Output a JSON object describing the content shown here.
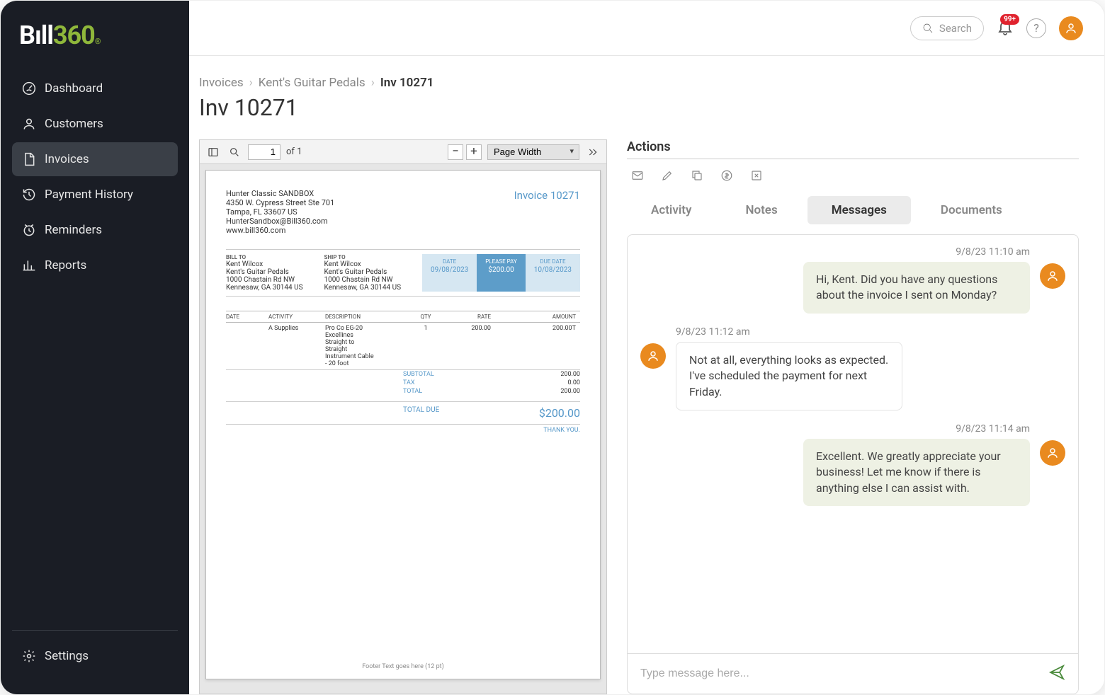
{
  "brand": {
    "part1": "B",
    "part2": "ıll",
    "part3": "360",
    "reg": "®"
  },
  "sidebar": {
    "items": [
      {
        "label": "Dashboard"
      },
      {
        "label": "Customers"
      },
      {
        "label": "Invoices"
      },
      {
        "label": "Payment History"
      },
      {
        "label": "Reminders"
      },
      {
        "label": "Reports"
      }
    ],
    "settings": "Settings"
  },
  "topbar": {
    "search_placeholder": "Search",
    "notification_badge": "99+"
  },
  "breadcrumb": {
    "c1": "Invoices",
    "c2": "Kent's Guitar Pedals",
    "c3": "Inv 10271"
  },
  "page_title": "Inv 10271",
  "pdf": {
    "page": "1",
    "of_label": "of 1",
    "zoom_mode": "Page Width"
  },
  "invoice": {
    "title": "Invoice  10271",
    "from": {
      "name": "Hunter Classic SANDBOX",
      "addr1": "4350 W. Cypress Street Ste 701",
      "addr2": "Tampa, FL  33607 US",
      "email": "HunterSandbox@Bill360.com",
      "web": "www.bill360.com"
    },
    "bill_to_label": "BILL TO",
    "ship_to_label": "SHIP TO",
    "bill_to": {
      "name": "Kent Wilcox",
      "company": "Kent's Guitar Pedals",
      "street": "1000 Chastain Rd NW",
      "city": "Kennesaw, GA  30144 US"
    },
    "ship_to": {
      "name": "Kent Wilcox",
      "company": "Kent's Guitar Pedals",
      "street": "1000 Chastain Rd NW",
      "city": "Kennesaw, GA  30144 US"
    },
    "boxes": {
      "date_label": "DATE",
      "date": "09/08/2023",
      "pay_label": "PLEASE PAY",
      "pay": "$200.00",
      "due_label": "DUE DATE",
      "due": "10/08/2023"
    },
    "cols": {
      "date": "DATE",
      "activity": "ACTIVITY",
      "desc": "DESCRIPTION",
      "qty": "QTY",
      "rate": "RATE",
      "amount": "AMOUNT"
    },
    "line": {
      "activity": "A Supplies",
      "desc1": "Pro Co EG-20",
      "desc2": "Excellines",
      "desc3": "Straight to",
      "desc4": "Straight",
      "desc5": "Instrument Cable",
      "desc6": "- 20 foot",
      "qty": "1",
      "rate": "200.00",
      "amount": "200.00T"
    },
    "totals": {
      "subtotal_l": "SUBTOTAL",
      "subtotal": "200.00",
      "tax_l": "TAX",
      "tax": "0.00",
      "total_l": "TOTAL",
      "total": "200.00",
      "due_l": "TOTAL DUE",
      "due": "$200.00",
      "thanks": "THANK YOU."
    },
    "footer": "Footer Text goes here (12 pt)"
  },
  "actions": {
    "title": "Actions",
    "tabs": {
      "activity": "Activity",
      "notes": "Notes",
      "messages": "Messages",
      "documents": "Documents"
    },
    "messages": [
      {
        "side": "right",
        "ts": "9/8/23 11:10 am",
        "text": "Hi, Kent. Did you have any questions about the invoice I sent on Monday?"
      },
      {
        "side": "left",
        "ts": "9/8/23 11:12 am",
        "text": "Not at all, everything looks as expected. I've scheduled the payment for next Friday."
      },
      {
        "side": "right",
        "ts": "9/8/23 11:14 am",
        "text": "Excellent. We greatly appreciate your business! Let me know if there is anything else I can assist with."
      }
    ],
    "input_placeholder": "Type message here..."
  }
}
